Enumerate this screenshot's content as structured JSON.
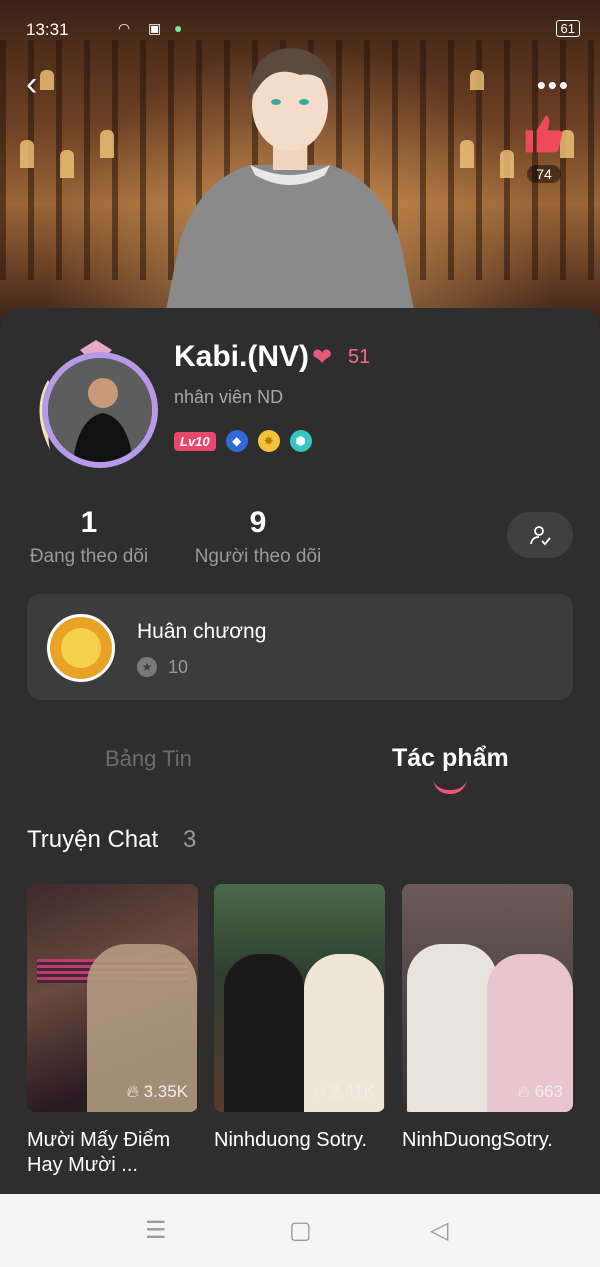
{
  "status_bar": {
    "time": "13:31",
    "battery": "61"
  },
  "hero": {
    "likes": "74"
  },
  "profile": {
    "name": "Kabi.(NV)",
    "heart_count": "51",
    "subtitle": "nhân viên ND",
    "level_badge": "Lv10"
  },
  "stats": {
    "following_count": "1",
    "following_label": "Đang theo dõi",
    "followers_count": "9",
    "followers_label": "Người theo dõi"
  },
  "medal": {
    "title": "Huân chương",
    "count": "10"
  },
  "tabs": [
    {
      "label": "Bảng Tin",
      "active": false
    },
    {
      "label": "Tác phẩm",
      "active": true
    }
  ],
  "section": {
    "title": "Truyện Chat",
    "count": "3"
  },
  "stories": [
    {
      "title": "Mười Mấy Điểm Hay Mười ...",
      "views": "3.35K"
    },
    {
      "title": "Ninhduong Sotry.",
      "views": "2.41K"
    },
    {
      "title": "NinhDuongSotry.",
      "views": "663"
    }
  ],
  "colors": {
    "accent": "#f0557a",
    "panel": "#2e2e2e",
    "card": "#3c3c3c"
  },
  "icons": {
    "back": "chevron-left-icon",
    "more": "more-dots-icon",
    "like": "thumbs-up-icon"
  }
}
